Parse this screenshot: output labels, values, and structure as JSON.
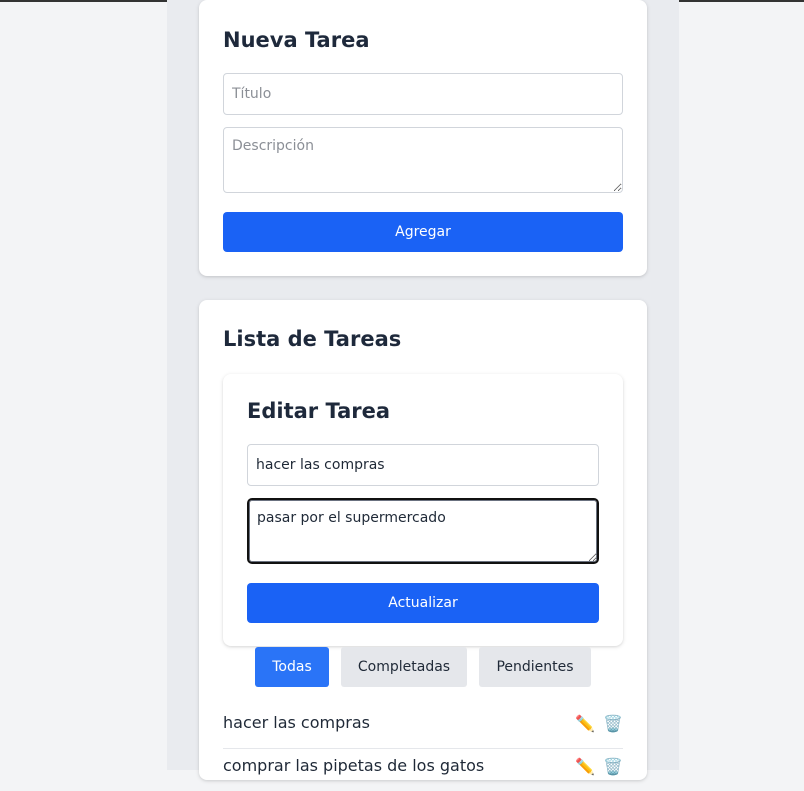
{
  "new_task": {
    "heading": "Nueva Tarea",
    "title_placeholder": "Título",
    "description_placeholder": "Descripción",
    "add_button": "Agregar"
  },
  "task_list": {
    "heading": "Lista de Tareas",
    "edit": {
      "heading": "Editar Tarea",
      "title_value": "hacer las compras",
      "description_value": "pasar por el supermercado",
      "update_button": "Actualizar"
    },
    "filters": [
      {
        "label": "Todas",
        "active": true
      },
      {
        "label": "Completadas",
        "active": false
      },
      {
        "label": "Pendientes",
        "active": false
      }
    ],
    "tasks": [
      {
        "title": "hacer las compras",
        "edit_icon": "pencil-icon",
        "delete_icon": "trash-icon"
      },
      {
        "title": "comprar las pipetas de los gatos",
        "edit_icon": "pencil-icon",
        "delete_icon": "trash-icon"
      }
    ]
  },
  "colors": {
    "primary": "#1a62f5",
    "active_filter": "#2a74f7",
    "inactive_filter": "#e5e7eb"
  }
}
